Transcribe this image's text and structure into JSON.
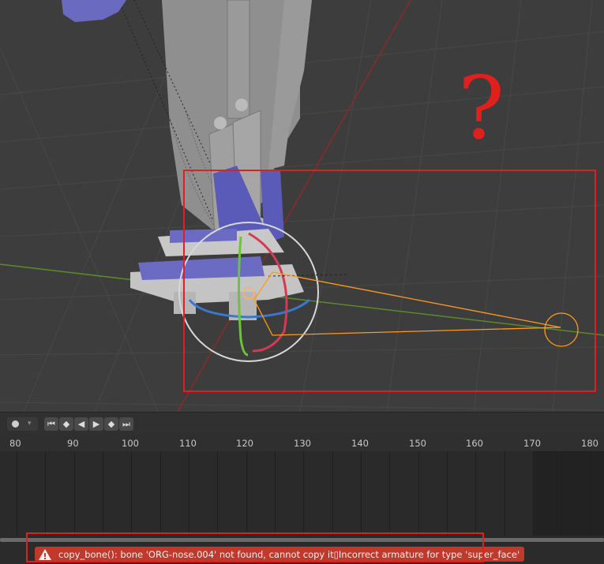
{
  "timeline": {
    "frame_labels": [
      "80",
      "90",
      "100",
      "110",
      "120",
      "130",
      "140",
      "150",
      "160",
      "170",
      "180"
    ],
    "record_icon": "record-dot-icon",
    "playback_icons": [
      "jump-start-icon",
      "prev-keyframe-icon",
      "play-reverse-icon",
      "play-icon",
      "next-keyframe-icon",
      "jump-end-icon"
    ]
  },
  "status": {
    "icon": "warning-icon",
    "message": "copy_bone(): bone 'ORG-nose.004' not found, cannot copy it▯Incorrect armature for type 'super_face'"
  },
  "annotation": {
    "question_mark": "?"
  },
  "colors": {
    "error_bg": "#c0392b",
    "annotation_red": "#e0201c",
    "viewport_bg": "#3d3d3d",
    "x_axis": "#8a2a2a",
    "y_axis": "#5a8a2a",
    "bone_orange": "#ff9a1a"
  }
}
